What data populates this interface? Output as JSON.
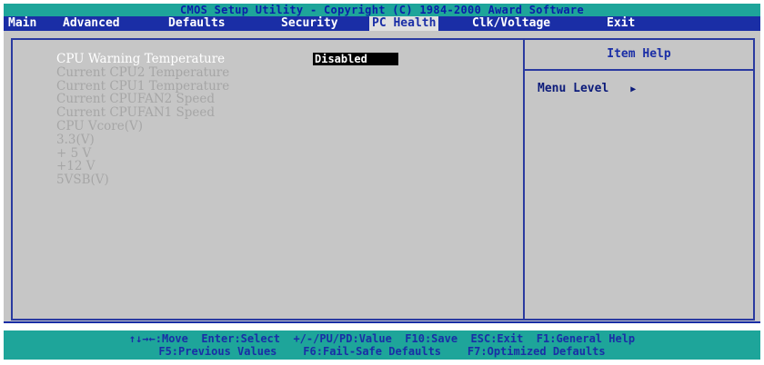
{
  "title": "CMOS Setup Utility - Copyright (C) 1984-2000 Award Software",
  "menu": [
    {
      "label": "Main",
      "active": false
    },
    {
      "label": "Advanced",
      "active": false
    },
    {
      "label": "Defaults",
      "active": false
    },
    {
      "label": "Security",
      "active": false
    },
    {
      "label": "PC Health",
      "active": true
    },
    {
      "label": "Clk/Voltage",
      "active": false
    },
    {
      "label": "Exit",
      "active": false
    }
  ],
  "items": [
    {
      "label": "CPU Warning Temperature",
      "selected": true,
      "value": "Disabled"
    },
    {
      "label": "Current CPU2 Temperature"
    },
    {
      "label": "Current CPU1 Temperature"
    },
    {
      "label": "Current CPUFAN2 Speed"
    },
    {
      "label": "Current CPUFAN1 Speed"
    },
    {
      "label": "CPU Vcore(V)"
    },
    {
      "label": "3.3(V)"
    },
    {
      "label": "+ 5 V"
    },
    {
      "label": "+12 V"
    },
    {
      "label": "5VSB(V)"
    }
  ],
  "help": {
    "title": "Item Help",
    "menu_level_label": "Menu Level",
    "menu_level_arrow": "▶"
  },
  "status": {
    "line1": "↑↓→←:Move  Enter:Select  +/-/PU/PD:Value  F10:Save  ESC:Exit  F1:General Help",
    "line2": "F5:Previous Values    F6:Fail-Safe Defaults    F7:Optimized Defaults"
  },
  "colors": {
    "menu_bg": "#1a2ea6",
    "title_bg": "#1ea59a",
    "panel_bg": "#c6c6c6",
    "item_text": "#a6a6a6",
    "selected_text": "#ffffff"
  }
}
